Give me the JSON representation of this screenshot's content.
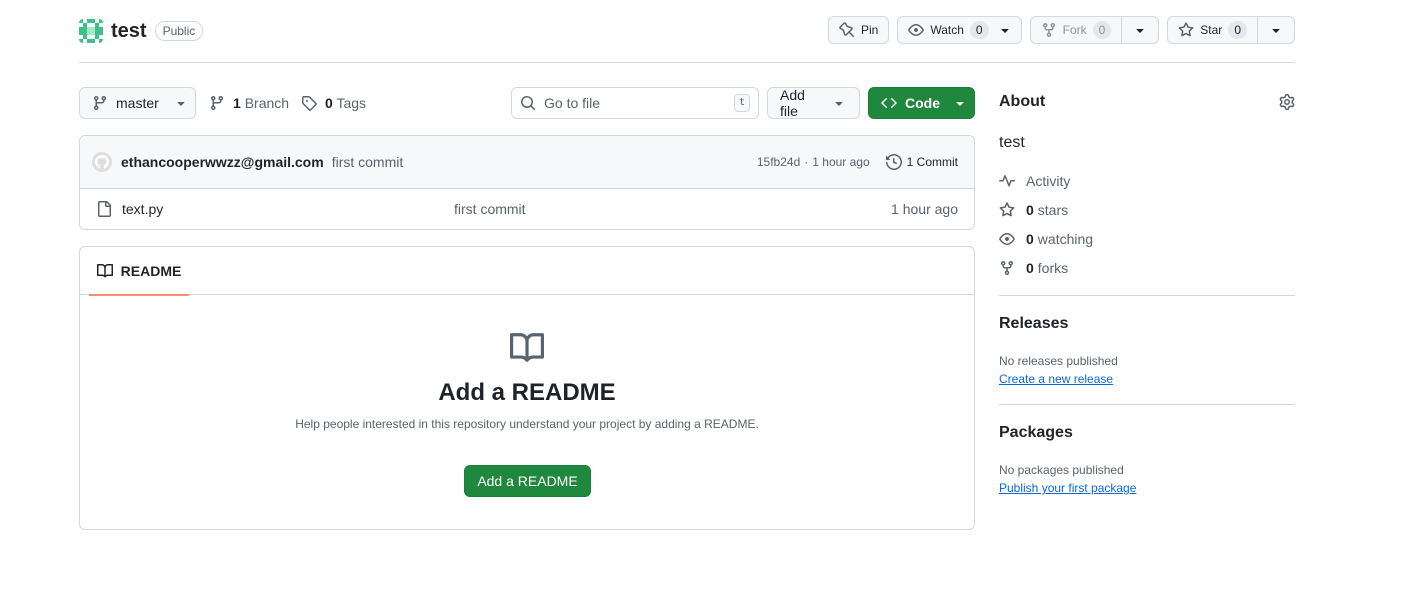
{
  "repo": {
    "name": "test",
    "visibility": "Public"
  },
  "actions": {
    "pin": "Pin",
    "watch": "Watch",
    "watch_count": "0",
    "fork": "Fork",
    "fork_count": "0",
    "star": "Star",
    "star_count": "0"
  },
  "toolbar": {
    "branch": "master",
    "branch_count": "1",
    "branch_label": "Branch",
    "tag_count": "0",
    "tag_label": "Tags",
    "search_placeholder": "Go to file",
    "search_kbd": "t",
    "add_file": "Add file",
    "code": "Code"
  },
  "commit": {
    "author": "ethancooperwwzz@gmail.com",
    "message": "first commit",
    "hash": "15fb24d",
    "separator": "·",
    "time": "1 hour ago",
    "commits_label": "1 Commit"
  },
  "files": [
    {
      "name": "text.py",
      "message": "first commit",
      "time": "1 hour ago"
    }
  ],
  "readme": {
    "tab": "README",
    "title": "Add a README",
    "description": "Help people interested in this repository understand your project by adding a README.",
    "button": "Add a README"
  },
  "about": {
    "heading": "About",
    "description": "test",
    "activity": "Activity",
    "stars_count": "0",
    "stars_label": "stars",
    "watching_count": "0",
    "watching_label": "watching",
    "forks_count": "0",
    "forks_label": "forks"
  },
  "releases": {
    "heading": "Releases",
    "text": "No releases published",
    "link": "Create a new release"
  },
  "packages": {
    "heading": "Packages",
    "text": "No packages published",
    "link": "Publish your first package"
  },
  "colors": {
    "accent_green": "#1f883d",
    "link_blue": "#0969da",
    "tab_underline": "#fd8c73",
    "border": "#d1d9e0"
  }
}
